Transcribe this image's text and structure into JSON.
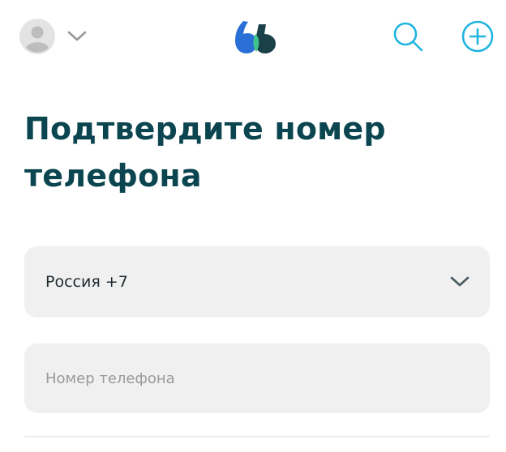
{
  "header": {
    "icons": {
      "avatar": "user-avatar-icon",
      "avatar_menu": "chevron-down-icon",
      "logo": "logo-icon",
      "search": "search-icon",
      "add": "plus-circle-icon"
    }
  },
  "main": {
    "title": "Подтвердите номер телефона",
    "country_select": {
      "value": "Россия +7",
      "icon": "chevron-down-icon"
    },
    "phone_input": {
      "value": "",
      "placeholder": "Номер телефона"
    }
  },
  "colors": {
    "accent": "#20b4e0",
    "title": "#0b4550",
    "field_bg": "#f0f0f0",
    "logo_blue": "#2a6fd6",
    "logo_green": "#3fc48c",
    "logo_dark": "#1a4048"
  }
}
